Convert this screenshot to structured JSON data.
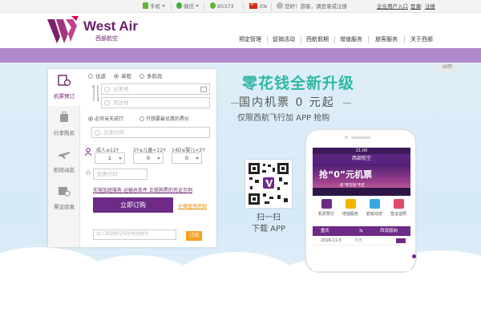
{
  "topbar": {
    "mobile_label": "手机",
    "wechat_label": "微信",
    "phone": "95373",
    "language": "EN",
    "greeting": "您好！游客，请",
    "login_register": "登录或注册",
    "enterprise_entry": "企业用户入口",
    "login": "登录",
    "slash": "/",
    "register": "注册"
  },
  "brand": {
    "name_en": "West Air",
    "name_cn": "西部航空",
    "color": "#6a1f6a"
  },
  "nav": {
    "items": [
      "预定管理",
      "促销活动",
      "西航假期",
      "增值服务",
      "旅客服务",
      "关于西部"
    ]
  },
  "badge": "W西",
  "booking": {
    "tabs": [
      "机票预订",
      "行李购买",
      "航班动态",
      "票证验真"
    ],
    "trip_types": [
      "往返",
      "单程",
      "多航段"
    ],
    "selected_trip_type": "单程",
    "departure_placeholder": "出发地",
    "arrival_placeholder": "到达地",
    "flexible_option": "必须当天成行",
    "lowest_price_option": "只想要最优惠的票价",
    "date_placeholder": "出发时间",
    "passenger_labels": [
      "成人≥12Y",
      "2Y≤儿童<12Y",
      "14D≤婴儿<2Y"
    ],
    "passenger_counts": [
      "1",
      "0",
      "0"
    ],
    "promo_code_placeholder": "优惠代码",
    "links": "实施加班服务  运输总条件  正规购票的凭证示例",
    "buy_button": "立即订购",
    "price_notice": "价格查询须知",
    "subscribe_placeholder": "加入西部航空特价短信邮件",
    "subscribe_button": "订阅"
  },
  "promo": {
    "headline": "零花钱全新升级",
    "subline": "国内机票 0 元起",
    "detail": "仅限西航飞行加 APP 抢购",
    "qr_caption_1": "扫一扫",
    "qr_caption_2": "下载 APP",
    "headline_color": "#2fb7a4"
  },
  "phone": {
    "status_time": "21:00",
    "app_title": "西部航空",
    "banner_title": "抢“0”元机票",
    "banner_sub": "新\"零花钱\"专区",
    "icons": [
      "机票预订",
      "增值服务",
      "航班动态",
      "签证证照"
    ],
    "from_city": "重庆",
    "to_city": "西双版纳",
    "date": "2016-11-5",
    "date_note": "今天"
  },
  "carousel": {
    "count": 6,
    "active": 0
  }
}
